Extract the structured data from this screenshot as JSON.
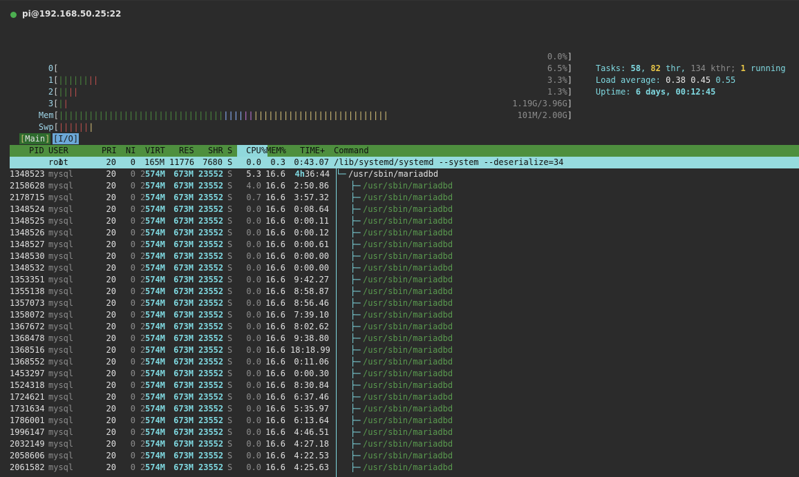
{
  "connection": {
    "title": "pi@192.168.50.25:22"
  },
  "meters": {
    "cpus": [
      {
        "label": "0",
        "value": "0.0%",
        "bars": ""
      },
      {
        "label": "1",
        "value": "6.5%",
        "bars": "||||||||"
      },
      {
        "label": "2",
        "value": "3.3%",
        "bars": "||||"
      },
      {
        "label": "3",
        "value": "1.3%",
        "bars": "||"
      }
    ],
    "mem": {
      "label": "Mem",
      "value": "1.19G/3.96G"
    },
    "swp": {
      "label": "Swp",
      "value": "101M/2.00G"
    }
  },
  "info": {
    "tasks_label": "Tasks:",
    "tasks": "58",
    "thr": "82",
    "thr_label": "thr,",
    "kthr": "134 kthr;",
    "running": "1",
    "running_label": "running",
    "load_label": "Load average:",
    "load1": "0.38",
    "load5": "0.45",
    "load15": "0.55",
    "uptime_label": "Uptime:",
    "uptime": "6 days, 00:12:45"
  },
  "tabs": {
    "main": "Main",
    "io": "I/O"
  },
  "columns": {
    "pid": "PID",
    "user": "USER",
    "pri": "PRI",
    "ni": "NI",
    "virt": "VIRT",
    "res": "RES",
    "shr": "SHR",
    "s": "S",
    "cpu": "CPU%",
    "mem": "MEM%",
    "time": "TIME+",
    "command": "Command"
  },
  "selected": {
    "pid": "1",
    "user": "root",
    "pri": "20",
    "ni": "0",
    "virt": "165M",
    "res": "11776",
    "shr": "7680",
    "s": "S",
    "cpu": "0.0",
    "mem": "0.3",
    "time": "0:43.07",
    "command": "/lib/systemd/systemd --system --deserialize=34"
  },
  "processes": [
    {
      "pid": "1348523",
      "user": "mysql",
      "pri": "20",
      "ni": "0",
      "virt_a": "2",
      "virt_b": "574M",
      "res": "673M",
      "shr": "23552",
      "s": "S",
      "cpu": "5.3",
      "mem": "16.6",
      "time_a": "4h",
      "time_b": "36:44",
      "tree": "└─",
      "command": "/usr/sbin/mariadbd",
      "parent": true
    },
    {
      "pid": "2158628",
      "user": "mysql",
      "pri": "20",
      "ni": "0",
      "virt_a": "2",
      "virt_b": "574M",
      "res": "673M",
      "shr": "23552",
      "s": "S",
      "cpu": "4.0",
      "mem": "16.6",
      "time_a": "",
      "time_b": "2:50.86",
      "tree": "├─",
      "command": "/usr/sbin/mariadbd",
      "parent": false
    },
    {
      "pid": "2178715",
      "user": "mysql",
      "pri": "20",
      "ni": "0",
      "virt_a": "2",
      "virt_b": "574M",
      "res": "673M",
      "shr": "23552",
      "s": "S",
      "cpu": "0.7",
      "mem": "16.6",
      "time_a": "",
      "time_b": "3:57.32",
      "tree": "├─",
      "command": "/usr/sbin/mariadbd",
      "parent": false
    },
    {
      "pid": "1348524",
      "user": "mysql",
      "pri": "20",
      "ni": "0",
      "virt_a": "2",
      "virt_b": "574M",
      "res": "673M",
      "shr": "23552",
      "s": "S",
      "cpu": "0.0",
      "mem": "16.6",
      "time_a": "",
      "time_b": "0:08.64",
      "tree": "├─",
      "command": "/usr/sbin/mariadbd",
      "parent": false
    },
    {
      "pid": "1348525",
      "user": "mysql",
      "pri": "20",
      "ni": "0",
      "virt_a": "2",
      "virt_b": "574M",
      "res": "673M",
      "shr": "23552",
      "s": "S",
      "cpu": "0.0",
      "mem": "16.6",
      "time_a": "",
      "time_b": "0:00.11",
      "tree": "├─",
      "command": "/usr/sbin/mariadbd",
      "parent": false
    },
    {
      "pid": "1348526",
      "user": "mysql",
      "pri": "20",
      "ni": "0",
      "virt_a": "2",
      "virt_b": "574M",
      "res": "673M",
      "shr": "23552",
      "s": "S",
      "cpu": "0.0",
      "mem": "16.6",
      "time_a": "",
      "time_b": "0:00.12",
      "tree": "├─",
      "command": "/usr/sbin/mariadbd",
      "parent": false
    },
    {
      "pid": "1348527",
      "user": "mysql",
      "pri": "20",
      "ni": "0",
      "virt_a": "2",
      "virt_b": "574M",
      "res": "673M",
      "shr": "23552",
      "s": "S",
      "cpu": "0.0",
      "mem": "16.6",
      "time_a": "",
      "time_b": "0:00.61",
      "tree": "├─",
      "command": "/usr/sbin/mariadbd",
      "parent": false
    },
    {
      "pid": "1348530",
      "user": "mysql",
      "pri": "20",
      "ni": "0",
      "virt_a": "2",
      "virt_b": "574M",
      "res": "673M",
      "shr": "23552",
      "s": "S",
      "cpu": "0.0",
      "mem": "16.6",
      "time_a": "",
      "time_b": "0:00.00",
      "tree": "├─",
      "command": "/usr/sbin/mariadbd",
      "parent": false
    },
    {
      "pid": "1348532",
      "user": "mysql",
      "pri": "20",
      "ni": "0",
      "virt_a": "2",
      "virt_b": "574M",
      "res": "673M",
      "shr": "23552",
      "s": "S",
      "cpu": "0.0",
      "mem": "16.6",
      "time_a": "",
      "time_b": "0:00.00",
      "tree": "├─",
      "command": "/usr/sbin/mariadbd",
      "parent": false
    },
    {
      "pid": "1353351",
      "user": "mysql",
      "pri": "20",
      "ni": "0",
      "virt_a": "2",
      "virt_b": "574M",
      "res": "673M",
      "shr": "23552",
      "s": "S",
      "cpu": "0.0",
      "mem": "16.6",
      "time_a": "",
      "time_b": "9:42.27",
      "tree": "├─",
      "command": "/usr/sbin/mariadbd",
      "parent": false
    },
    {
      "pid": "1355138",
      "user": "mysql",
      "pri": "20",
      "ni": "0",
      "virt_a": "2",
      "virt_b": "574M",
      "res": "673M",
      "shr": "23552",
      "s": "S",
      "cpu": "0.0",
      "mem": "16.6",
      "time_a": "",
      "time_b": "8:58.87",
      "tree": "├─",
      "command": "/usr/sbin/mariadbd",
      "parent": false
    },
    {
      "pid": "1357073",
      "user": "mysql",
      "pri": "20",
      "ni": "0",
      "virt_a": "2",
      "virt_b": "574M",
      "res": "673M",
      "shr": "23552",
      "s": "S",
      "cpu": "0.0",
      "mem": "16.6",
      "time_a": "",
      "time_b": "8:56.46",
      "tree": "├─",
      "command": "/usr/sbin/mariadbd",
      "parent": false
    },
    {
      "pid": "1358072",
      "user": "mysql",
      "pri": "20",
      "ni": "0",
      "virt_a": "2",
      "virt_b": "574M",
      "res": "673M",
      "shr": "23552",
      "s": "S",
      "cpu": "0.0",
      "mem": "16.6",
      "time_a": "",
      "time_b": "7:39.10",
      "tree": "├─",
      "command": "/usr/sbin/mariadbd",
      "parent": false
    },
    {
      "pid": "1367672",
      "user": "mysql",
      "pri": "20",
      "ni": "0",
      "virt_a": "2",
      "virt_b": "574M",
      "res": "673M",
      "shr": "23552",
      "s": "S",
      "cpu": "0.0",
      "mem": "16.6",
      "time_a": "",
      "time_b": "8:02.62",
      "tree": "├─",
      "command": "/usr/sbin/mariadbd",
      "parent": false
    },
    {
      "pid": "1368478",
      "user": "mysql",
      "pri": "20",
      "ni": "0",
      "virt_a": "2",
      "virt_b": "574M",
      "res": "673M",
      "shr": "23552",
      "s": "S",
      "cpu": "0.0",
      "mem": "16.6",
      "time_a": "",
      "time_b": "9:38.80",
      "tree": "├─",
      "command": "/usr/sbin/mariadbd",
      "parent": false
    },
    {
      "pid": "1368516",
      "user": "mysql",
      "pri": "20",
      "ni": "0",
      "virt_a": "2",
      "virt_b": "574M",
      "res": "673M",
      "shr": "23552",
      "s": "S",
      "cpu": "0.0",
      "mem": "16.6",
      "time_a": "",
      "time_b": "18:18.99",
      "tree": "├─",
      "command": "/usr/sbin/mariadbd",
      "parent": false
    },
    {
      "pid": "1368552",
      "user": "mysql",
      "pri": "20",
      "ni": "0",
      "virt_a": "2",
      "virt_b": "574M",
      "res": "673M",
      "shr": "23552",
      "s": "S",
      "cpu": "0.0",
      "mem": "16.6",
      "time_a": "",
      "time_b": "0:11.06",
      "tree": "├─",
      "command": "/usr/sbin/mariadbd",
      "parent": false
    },
    {
      "pid": "1453297",
      "user": "mysql",
      "pri": "20",
      "ni": "0",
      "virt_a": "2",
      "virt_b": "574M",
      "res": "673M",
      "shr": "23552",
      "s": "S",
      "cpu": "0.0",
      "mem": "16.6",
      "time_a": "",
      "time_b": "0:00.30",
      "tree": "├─",
      "command": "/usr/sbin/mariadbd",
      "parent": false
    },
    {
      "pid": "1524318",
      "user": "mysql",
      "pri": "20",
      "ni": "0",
      "virt_a": "2",
      "virt_b": "574M",
      "res": "673M",
      "shr": "23552",
      "s": "S",
      "cpu": "0.0",
      "mem": "16.6",
      "time_a": "",
      "time_b": "8:30.84",
      "tree": "├─",
      "command": "/usr/sbin/mariadbd",
      "parent": false
    },
    {
      "pid": "1724621",
      "user": "mysql",
      "pri": "20",
      "ni": "0",
      "virt_a": "2",
      "virt_b": "574M",
      "res": "673M",
      "shr": "23552",
      "s": "S",
      "cpu": "0.0",
      "mem": "16.6",
      "time_a": "",
      "time_b": "6:37.46",
      "tree": "├─",
      "command": "/usr/sbin/mariadbd",
      "parent": false
    },
    {
      "pid": "1731634",
      "user": "mysql",
      "pri": "20",
      "ni": "0",
      "virt_a": "2",
      "virt_b": "574M",
      "res": "673M",
      "shr": "23552",
      "s": "S",
      "cpu": "0.0",
      "mem": "16.6",
      "time_a": "",
      "time_b": "5:35.97",
      "tree": "├─",
      "command": "/usr/sbin/mariadbd",
      "parent": false
    },
    {
      "pid": "1786001",
      "user": "mysql",
      "pri": "20",
      "ni": "0",
      "virt_a": "2",
      "virt_b": "574M",
      "res": "673M",
      "shr": "23552",
      "s": "S",
      "cpu": "0.0",
      "mem": "16.6",
      "time_a": "",
      "time_b": "6:13.64",
      "tree": "├─",
      "command": "/usr/sbin/mariadbd",
      "parent": false
    },
    {
      "pid": "1996147",
      "user": "mysql",
      "pri": "20",
      "ni": "0",
      "virt_a": "2",
      "virt_b": "574M",
      "res": "673M",
      "shr": "23552",
      "s": "S",
      "cpu": "0.0",
      "mem": "16.6",
      "time_a": "",
      "time_b": "4:46.51",
      "tree": "├─",
      "command": "/usr/sbin/mariadbd",
      "parent": false
    },
    {
      "pid": "2032149",
      "user": "mysql",
      "pri": "20",
      "ni": "0",
      "virt_a": "2",
      "virt_b": "574M",
      "res": "673M",
      "shr": "23552",
      "s": "S",
      "cpu": "0.0",
      "mem": "16.6",
      "time_a": "",
      "time_b": "4:27.18",
      "tree": "├─",
      "command": "/usr/sbin/mariadbd",
      "parent": false
    },
    {
      "pid": "2058606",
      "user": "mysql",
      "pri": "20",
      "ni": "0",
      "virt_a": "2",
      "virt_b": "574M",
      "res": "673M",
      "shr": "23552",
      "s": "S",
      "cpu": "0.0",
      "mem": "16.6",
      "time_a": "",
      "time_b": "4:22.53",
      "tree": "├─",
      "command": "/usr/sbin/mariadbd",
      "parent": false
    },
    {
      "pid": "2061582",
      "user": "mysql",
      "pri": "20",
      "ni": "0",
      "virt_a": "2",
      "virt_b": "574M",
      "res": "673M",
      "shr": "23552",
      "s": "S",
      "cpu": "0.0",
      "mem": "16.6",
      "time_a": "",
      "time_b": "4:25.63",
      "tree": "├─",
      "command": "/usr/sbin/mariadbd",
      "parent": false
    }
  ]
}
